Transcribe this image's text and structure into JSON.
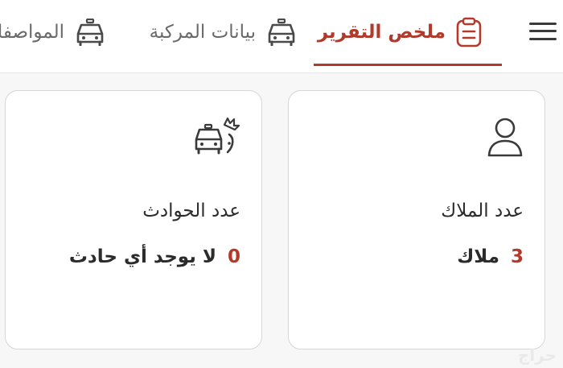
{
  "tabs": [
    {
      "label": "ملخص التقرير",
      "icon": "clipboard-icon",
      "active": true
    },
    {
      "label": "بيانات المركبة",
      "icon": "car-icon",
      "active": false
    },
    {
      "label": "المواصفات",
      "icon": "car-icon",
      "active": false
    }
  ],
  "cards": {
    "owners": {
      "icon": "person-icon",
      "title": "عدد الملاك",
      "number": "3",
      "text": "ملاك"
    },
    "accidents": {
      "icon": "car-crash-icon",
      "title": "عدد الحوادث",
      "number": "0",
      "text": "لا يوجد أي حادث"
    }
  },
  "watermark": "حراج",
  "colors": {
    "accent": "#b33a2b",
    "muted_text": "#6a6a6a",
    "text": "#2b2b2b",
    "background": "#f7f7f7",
    "card_border": "#d6d6d6"
  }
}
